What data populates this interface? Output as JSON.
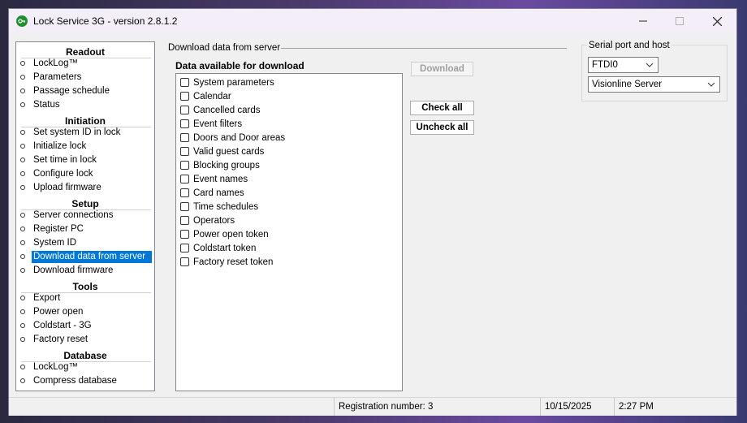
{
  "window": {
    "title": "Lock Service 3G - version 2.8.1.2"
  },
  "sidebar": {
    "groups": [
      {
        "title": "Readout",
        "items": [
          "LockLog™",
          "Parameters",
          "Passage schedule",
          "Status"
        ]
      },
      {
        "title": "Initiation",
        "items": [
          "Set system ID in lock",
          "Initialize lock",
          "Set time in lock",
          "Configure lock",
          "Upload firmware"
        ]
      },
      {
        "title": "Setup",
        "items": [
          "Server connections",
          "Register PC",
          "System ID",
          "Download data from server",
          "Download firmware"
        ]
      },
      {
        "title": "Tools",
        "items": [
          "Export",
          "Power open",
          "Coldstart - 3G",
          "Factory reset"
        ]
      },
      {
        "title": "Database",
        "items": [
          "LockLog™",
          "Compress database"
        ]
      }
    ],
    "selected": "Download data from server"
  },
  "main": {
    "section_title": "Download data from server",
    "available_label": "Data available for download",
    "items": [
      "System parameters",
      "Calendar",
      "Cancelled cards",
      "Event filters",
      "Doors and Door areas",
      "Valid guest cards",
      "Blocking groups",
      "Event names",
      "Card names",
      "Time schedules",
      "Operators",
      "Power open token",
      "Coldstart token",
      "Factory reset token"
    ],
    "download_label": "Download",
    "check_all_label": "Check all",
    "uncheck_all_label": "Uncheck all"
  },
  "serial": {
    "title": "Serial port and host",
    "port": "FTDI0",
    "host": "Visionline Server"
  },
  "status": {
    "registration": "Registration number: 3",
    "date": "10/15/2025",
    "time": "2:27 PM"
  },
  "icons": {
    "app": "key-icon",
    "minimize": "minimize-icon",
    "maximize": "maximize-icon",
    "close": "close-icon"
  },
  "colors": {
    "selection": "#0078d7",
    "app_icon": "#1f8f2f"
  }
}
